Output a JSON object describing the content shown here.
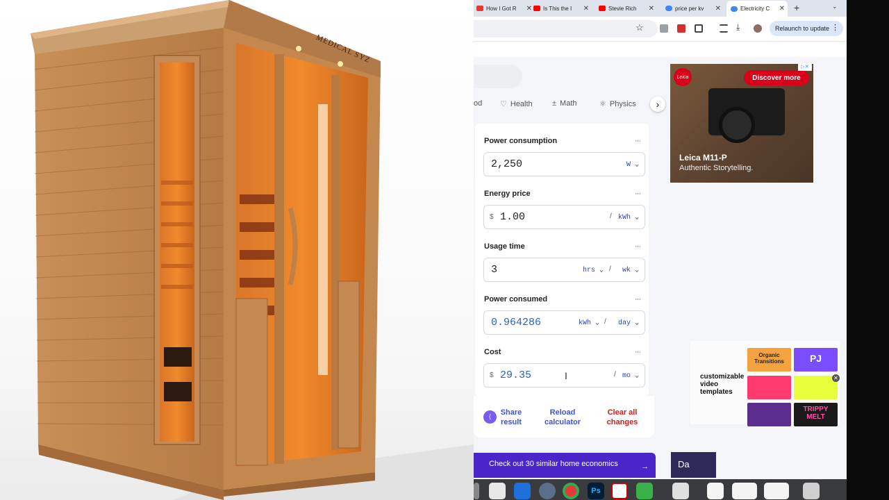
{
  "browser": {
    "tabs": [
      {
        "title": "How I Got R",
        "color": "#e53935"
      },
      {
        "title": "Is This the I",
        "color": "#ff0000"
      },
      {
        "title": "Stevie Rich",
        "color": "#ff0000"
      },
      {
        "title": "price per kv",
        "color": "#4285f4"
      },
      {
        "title": "Electricity C",
        "color": "#4285f4",
        "active": true
      }
    ],
    "new_tab": "+",
    "relaunch_label": "Relaunch to update"
  },
  "categories": [
    {
      "label": "od"
    },
    {
      "label": "Health",
      "icon": "heart-icon"
    },
    {
      "label": "Math",
      "icon": "math-icon"
    },
    {
      "label": "Physics",
      "icon": "physics-icon"
    }
  ],
  "calculator": {
    "power_consumption": {
      "label": "Power consumption",
      "value": "2,250",
      "unit": "W"
    },
    "energy_price": {
      "label": "Energy price",
      "currency": "$",
      "value": "1.00",
      "per": "/",
      "unit": "kWh"
    },
    "usage_time": {
      "label": "Usage time",
      "value": "3",
      "unit": "hrs",
      "per": "/",
      "period": "wk"
    },
    "power_consumed": {
      "label": "Power consumed",
      "value": "0.964286",
      "unit": "kWh",
      "per": "/",
      "period": "day"
    },
    "cost": {
      "label": "Cost",
      "currency": "$",
      "value": "29.35",
      "per": "/",
      "period": "mo"
    },
    "more": "···"
  },
  "actions": {
    "share": "Share result",
    "reload": "Reload calculator",
    "clear": "Clear all changes"
  },
  "banner": {
    "text": "Check out 30 similar home economics",
    "arrow": "→"
  },
  "dark_strip": {
    "text": "Da"
  },
  "ad": {
    "brand": "Leica",
    "cta": "Discover more",
    "title": "Leica M11-P",
    "subtitle": "Authentic Storytelling.",
    "choices": "▷✕"
  },
  "video_ad": {
    "text": "customizable video templates",
    "thumbs": [
      {
        "label": "Organic Transitions",
        "color": "#f4a340"
      },
      {
        "label": "PJ",
        "color": "#7a4dff"
      },
      {
        "label": "",
        "color": "#ff3a6e"
      },
      {
        "label": "",
        "color": "#e6ff3a"
      },
      {
        "label": "",
        "color": "#5b2d8c"
      },
      {
        "label": "TRIPPY MELT",
        "color": "#1a1a1a"
      }
    ]
  },
  "sauna": {
    "brand": "MEDICAL SYZ"
  }
}
